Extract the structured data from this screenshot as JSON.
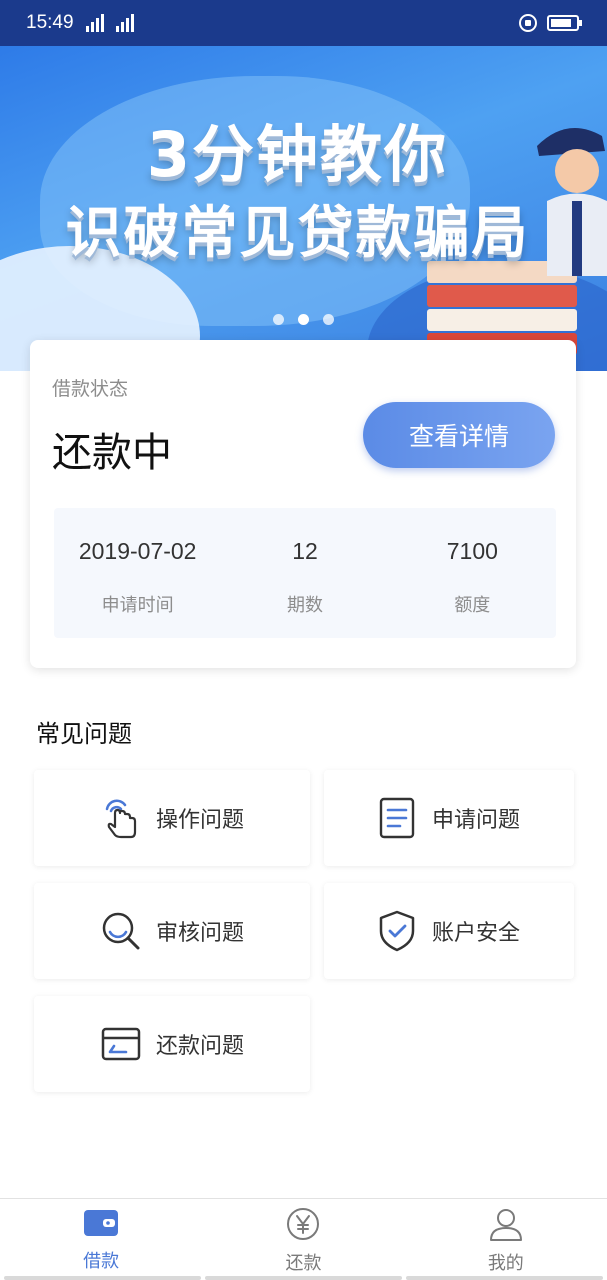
{
  "status_bar": {
    "time": "15:49",
    "network_1": "4G",
    "network_2": "3G"
  },
  "banner": {
    "line1": "3分钟教你",
    "line2": "识破常见贷款骗局",
    "page_count": 3,
    "active_page": 2
  },
  "loan": {
    "status_label": "借款状态",
    "status_value": "还款中",
    "detail_button": "查看详情",
    "stats": [
      {
        "value": "2019-07-02",
        "label": "申请时间"
      },
      {
        "value": "12",
        "label": "期数"
      },
      {
        "value": "7100",
        "label": "额度"
      }
    ]
  },
  "faq": {
    "title": "常见问题",
    "items": [
      {
        "label": "操作问题",
        "icon": "tap-hand-icon"
      },
      {
        "label": "申请问题",
        "icon": "document-icon"
      },
      {
        "label": "审核问题",
        "icon": "magnifier-icon"
      },
      {
        "label": "账户安全",
        "icon": "shield-check-icon"
      },
      {
        "label": "还款问题",
        "icon": "card-icon"
      }
    ]
  },
  "nav": {
    "items": [
      {
        "label": "借款",
        "icon": "wallet-icon",
        "active": true
      },
      {
        "label": "还款",
        "icon": "yen-icon",
        "active": false
      },
      {
        "label": "我的",
        "icon": "user-icon",
        "active": false
      }
    ]
  },
  "colors": {
    "accent": "#4a78d6",
    "status_bar": "#1b3a8c",
    "banner_blue": "#2e7be8"
  }
}
